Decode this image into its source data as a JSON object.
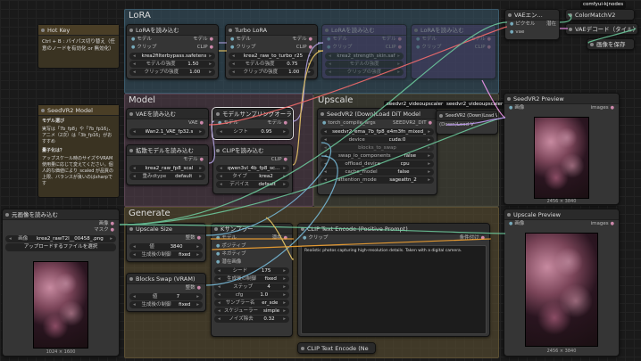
{
  "groups": {
    "lora": "LoRA",
    "model": "Model",
    "upscale": "Upscale",
    "generate": "Generate"
  },
  "hotkey": {
    "title": "Hot Key",
    "body": "Ctrl + B : バイパス切り替え（任意のノードを有効化 or 無効化）"
  },
  "lora1": {
    "title": "LoRAを読み込む",
    "in_model": "モデル",
    "out_model": "モデル",
    "in_clip": "クリップ",
    "out_clip": "CLIP",
    "lora_name": "krea2filterbypass.safetens",
    "strength_model_label": "モデルの強度",
    "strength_model": "1.50",
    "strength_clip_label": "クリップの強度",
    "strength_clip": "1.00"
  },
  "lora2": {
    "title": "Turbo LoRA",
    "in_model": "モデル",
    "out_model": "モデル",
    "in_clip": "クリップ",
    "out_clip": "CLIP",
    "lora_name": "krea2_raw_to_turbo_r25",
    "strength_model_label": "モデルの強度",
    "strength_model": "0.75",
    "strength_clip_label": "クリップの強度",
    "strength_clip": "1.00"
  },
  "lora3": {
    "title": "LoRAを読み込む",
    "in_model": "モデル",
    "out_model": "モデル",
    "in_clip": "クリップ",
    "out_clip": "CLIP",
    "lora_name": "krea2_strength_skin.saf",
    "w2": "モデルの強度",
    "w3": "クリップの強度"
  },
  "lora4": {
    "title": "LoRAを読み込む",
    "in_model": "モデル",
    "out_model": "モデル",
    "in_clip": "クリップ",
    "out_clip": "CLIP"
  },
  "seedvr_note": {
    "title": "SeedVR2 Model",
    "h1": "モデル選び",
    "p1": "実写は「7b_fp8」や「7b_fp16」、アニメ（2次）は「3b_fp16」がおすすめ",
    "h2": "量子化は？",
    "p2": "アップスケール時のサイズやVRAM使用量に応じて変えてください。個人的な価値により_scaled が品質の上限、バランスが良いのはsharpです"
  },
  "vae_loader": {
    "title": "VAEを読み込む",
    "out": "VAE",
    "name": "Wan2.1_VAE_fp32.s"
  },
  "model_sampling": {
    "title": "モデルサンプリングオーラ...",
    "in": "モデル",
    "out": "モデル",
    "shift_label": "シフト",
    "shift": "0.95"
  },
  "diffusion_loader": {
    "title": "拡散モデルを読み込む",
    "out": "モデル",
    "name": "krea2_raw_fp8_scal",
    "dtype_label": "重みdtype",
    "dtype": "default"
  },
  "clip_loader": {
    "title": "CLIPを読み込む",
    "out": "CLIP",
    "name": "qwen3vl_4b_fp8_scaled.saf",
    "type_label": "タイプ",
    "type": "krea2",
    "device_label": "デバイス",
    "device": "default"
  },
  "seedvr_dit": {
    "title": "SeedVR2 (Down)Load DiT Model",
    "compile_label": "torch_compile_args",
    "out": "SEEDVR2_DIT",
    "model": "seedvr2_ema_7b_fp8_e4m3fn_mixed_",
    "device_label": "device",
    "device": "cuda:0",
    "blocks_label": "blocks_to_swap",
    "swap_io_label": "swap_io_components",
    "swap_io": "false",
    "offload_label": "offload_device",
    "offload": "cpu",
    "cache_label": "cache_model",
    "cache": "false",
    "attn_label": "attention_mode",
    "attn": "sageattn_2"
  },
  "tags": {
    "t1": "seedvr2_videoupscaler",
    "t2": "seedvr2_videoupscaler",
    "t3": "comfyui-kjnodes"
  },
  "seedvr_vae": {
    "title": "(Down)Load V",
    "hdr": "SeedVR2 (Down)Load VAE"
  },
  "vae_encode": {
    "title": "VAEエン...",
    "in_pixels": "ピクセル",
    "in_vae": "vae"
  },
  "colormatch": {
    "title": "ColorMatchV2"
  },
  "vae_decode": {
    "title": "VAEデコード（タイル）",
    "out": "画像"
  },
  "save_image": {
    "title": "画像を保存"
  },
  "preview1": {
    "title": "SeedVR2 Preview",
    "in": "画像",
    "out": "images",
    "caption": "2456 × 3840"
  },
  "preview2": {
    "title": "Upscale Preview",
    "in": "画像",
    "out": "images",
    "caption": "2456 × 3840"
  },
  "load_image": {
    "title": "元画像を読み込む",
    "out_image": "画像",
    "out_mask": "マスク",
    "image_label": "画像",
    "image": "krea2_rawT2I__00458_.png",
    "upload": "アップロードするファイルを選択",
    "caption": "1024 × 1600"
  },
  "upscale_size": {
    "title": "Upscale Size",
    "out": "整数",
    "v_label": "値",
    "v": "3840",
    "ctl_label": "生成後の制御",
    "ctl": "fixed"
  },
  "blocks_swap": {
    "title": "Blocks Swap (VRAM)",
    "out": "整数",
    "v_label": "値",
    "v": "7",
    "ctl_label": "生成後の制御",
    "ctl": "fixed"
  },
  "ksampler": {
    "title": "Kサンプラー",
    "in_model": "モデル",
    "out": "潜在",
    "in_pos": "ポジティブ",
    "in_neg": "ネガティブ",
    "in_latent": "潜在画像",
    "seed_label": "シード",
    "seed": "175",
    "ctl_label": "生成後の制御",
    "ctl": "fixed",
    "steps_label": "ステップ",
    "steps": "4",
    "cfg_label": "cfg",
    "cfg": "1.0",
    "sampler_label": "サンプラー名",
    "sampler": "er_sde",
    "sched_label": "スケジューラー",
    "sched": "simple",
    "denoise_label": "ノイズ除去",
    "denoise": "0.32"
  },
  "clip_pos": {
    "title": "CLIP Text Encode (Positive Prompt)",
    "in": "クリップ",
    "out": "条件付け",
    "text": "Realistic photos capturing high-resolution details. Taken with a digital camera."
  },
  "clip_neg": {
    "title": "CLIP Text Encode (Ne"
  },
  "colors": {
    "lora_group": "#3b5a6b",
    "model_group": "#5a4452",
    "upscale_group": "#4a4a3c",
    "generate_group": "#5a4e32",
    "canvas": "#1a1a1a"
  }
}
